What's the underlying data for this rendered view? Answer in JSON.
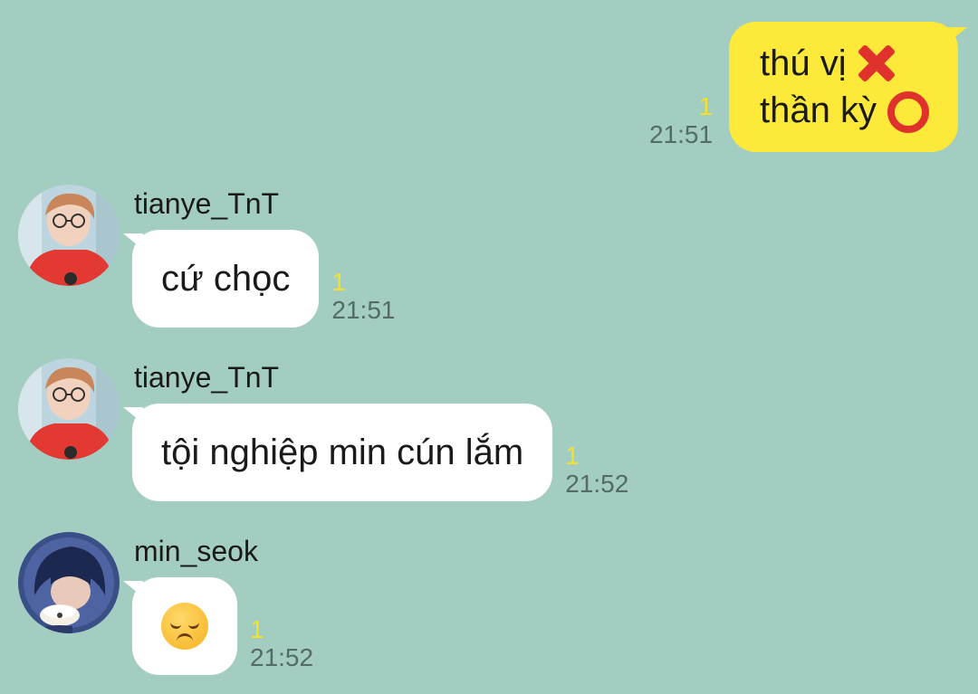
{
  "colors": {
    "background": "#a3cdc0",
    "outgoing_bubble": "#fde93a",
    "incoming_bubble": "#ffffff",
    "unread_count": "#f3e12b",
    "timestamp": "#556b66"
  },
  "outgoing": {
    "line1": "thú vị",
    "line1_icon": "red-cross-mark-icon",
    "line2": "thần kỳ",
    "line2_icon": "red-circle-mark-icon",
    "unread": "1",
    "time": "21:51"
  },
  "messages": [
    {
      "sender": "tianye_TnT",
      "avatar": "user-avatar-photo",
      "text": "cứ chọc",
      "unread": "1",
      "time": "21:51"
    },
    {
      "sender": "tianye_TnT",
      "avatar": "user-avatar-photo",
      "text": "tội nghiệp min cún lắm",
      "unread": "1",
      "time": "21:52"
    },
    {
      "sender": "min_seok",
      "avatar": "user-avatar-photo",
      "emoji": "disappointed-face-emoji",
      "unread": "1",
      "time": "21:52"
    }
  ]
}
